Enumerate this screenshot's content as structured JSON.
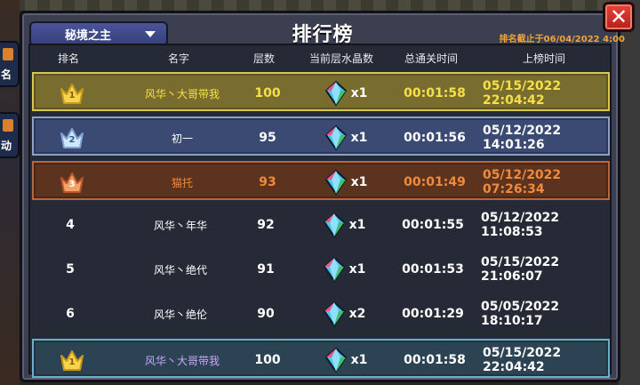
{
  "panel": {
    "title": "排行榜",
    "dropdown_label": "秘境之主",
    "cutoff_text": "排名截止于06/04/2022 4:00",
    "close_label": "✕"
  },
  "side_tabs": [
    {
      "glyph": "名"
    },
    {
      "glyph": "动"
    }
  ],
  "headers": {
    "rank": "排名",
    "name": "名字",
    "layer": "层数",
    "crystal": "当前层水晶数",
    "total_time": "总通关时间",
    "rank_time": "上榜时间"
  },
  "colors": {
    "gold_text": "#f5e04a",
    "silver_text": "#ffffff",
    "bronze_text": "#f08a3c",
    "plain_text": "#ffffff",
    "self_name": "#c9a4ff"
  },
  "rows": [
    {
      "rank": "1",
      "name": "风华丶大哥带我",
      "layer": "100",
      "crystal_icon": "crystal-icon",
      "crystal_qty": "x1",
      "total_time": "00:01:58",
      "rank_time": "05/15/2022 22:04:42",
      "style": "gold"
    },
    {
      "rank": "2",
      "name": "初一",
      "layer": "95",
      "crystal_icon": "crystal-icon",
      "crystal_qty": "x1",
      "total_time": "00:01:56",
      "rank_time": "05/12/2022 14:01:26",
      "style": "silver"
    },
    {
      "rank": "3",
      "name": "猫托",
      "layer": "93",
      "crystal_icon": "crystal-icon",
      "crystal_qty": "x1",
      "total_time": "00:01:49",
      "rank_time": "05/12/2022 07:26:34",
      "style": "bronze"
    },
    {
      "rank": "4",
      "name": "风华丶年华",
      "layer": "92",
      "crystal_icon": "crystal-icon",
      "crystal_qty": "x1",
      "total_time": "00:01:55",
      "rank_time": "05/12/2022 11:08:53",
      "style": "plain"
    },
    {
      "rank": "5",
      "name": "风华丶绝代",
      "layer": "91",
      "crystal_icon": "crystal-icon",
      "crystal_qty": "x1",
      "total_time": "00:01:53",
      "rank_time": "05/15/2022 21:06:07",
      "style": "plain"
    },
    {
      "rank": "6",
      "name": "风华丶绝伦",
      "layer": "90",
      "crystal_icon": "crystal-icon",
      "crystal_qty": "x2",
      "total_time": "00:01:29",
      "rank_time": "05/05/2022 18:10:17",
      "style": "plain"
    },
    {
      "rank": "1",
      "name": "风华丶大哥带我",
      "layer": "100",
      "crystal_icon": "crystal-icon",
      "crystal_qty": "x1",
      "total_time": "00:01:58",
      "rank_time": "05/15/2022 22:04:42",
      "style": "self"
    }
  ]
}
